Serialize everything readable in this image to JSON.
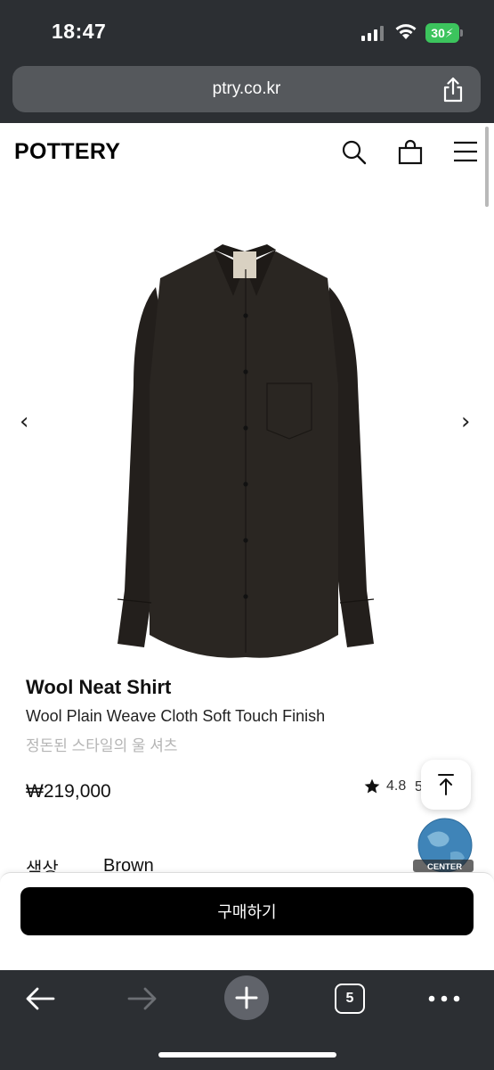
{
  "status_bar": {
    "time": "18:47",
    "battery": "30"
  },
  "browser": {
    "url": "ptry.co.kr",
    "tabs_count": "5"
  },
  "site": {
    "logo": "POTTERY"
  },
  "product": {
    "name": "Wool Neat Shirt",
    "subtitle": "Wool Plain Weave Cloth Soft Touch Finish",
    "description_kr": "정돈된 스타일의 울 셔츠",
    "price": "₩219,000",
    "rating": "4.8",
    "rating_extra": "5",
    "color_label": "색상",
    "color_value": "Brown",
    "shirt_color": "#2a2622"
  },
  "carousel": {
    "prev": "‹",
    "next": "›"
  },
  "badge": {
    "text": "CENTER"
  },
  "buy": {
    "label": "구매하기"
  },
  "colors": {
    "browser_chrome": "#2c2f33",
    "battery": "#3cc45d",
    "buy_button": "#000000"
  }
}
